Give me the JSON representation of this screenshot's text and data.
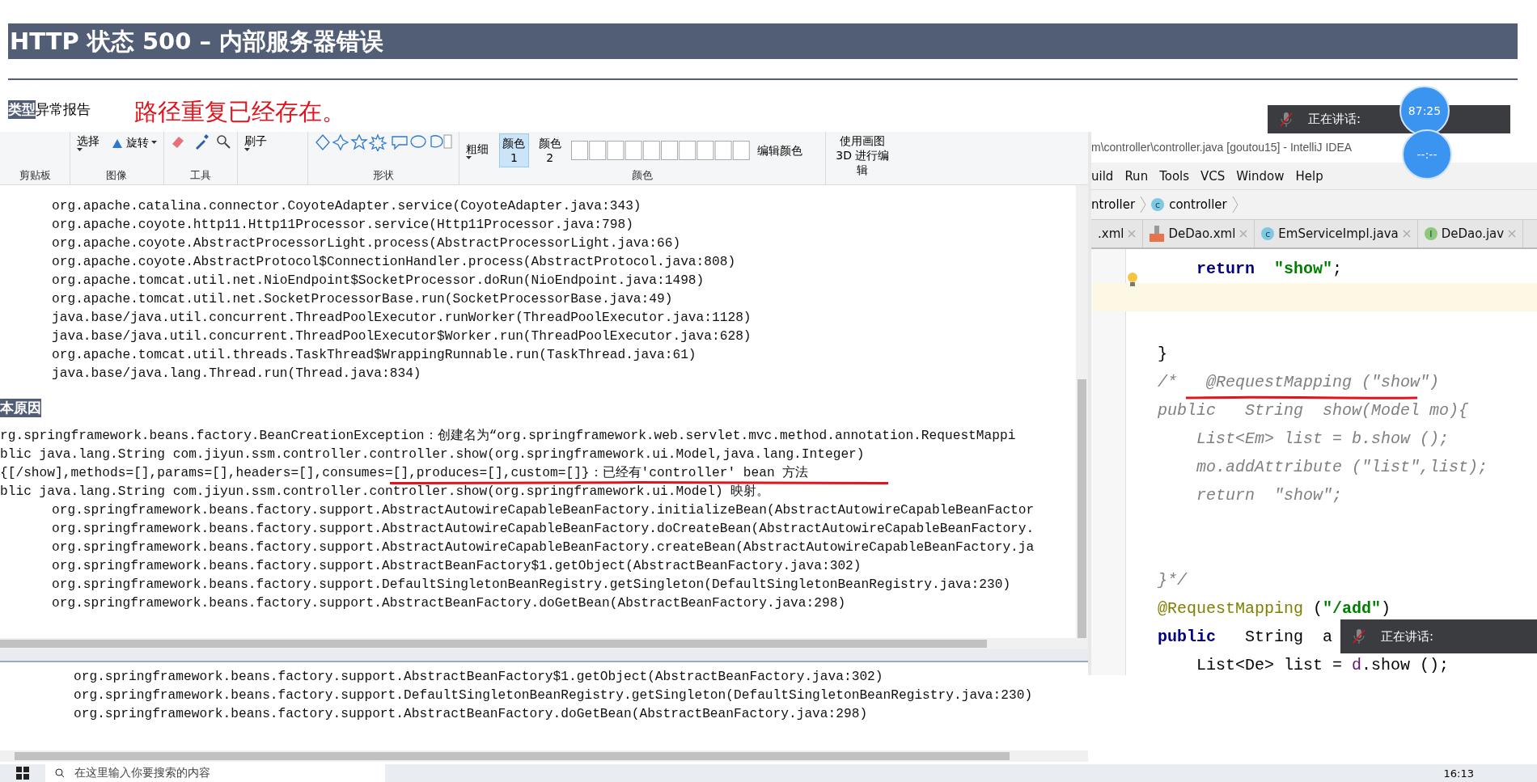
{
  "error_page": {
    "title": "HTTP 状态 500 – 内部服务器错误",
    "type_label": "类型",
    "type_value": "异常报告",
    "annotation": "路径重复已经存在。"
  },
  "paint_ribbon": {
    "groups": [
      {
        "label": "剪贴板"
      },
      {
        "label": "图像",
        "tools": [
          {
            "kind": "stacked",
            "label": "选择"
          },
          {
            "kind": "rotate",
            "label": "旋转"
          }
        ]
      },
      {
        "label": "工具",
        "tools": [
          {
            "kind": "toolset"
          }
        ]
      },
      {
        "tools": [
          {
            "kind": "stacked",
            "label": "刷子"
          }
        ]
      },
      {
        "label": "形状",
        "tools": [
          {
            "kind": "shapes"
          }
        ]
      },
      {
        "label": "颜色",
        "tools": [
          {
            "kind": "stacked",
            "label": "粗细"
          },
          {
            "kind": "color-slot",
            "label": "颜色 1",
            "selected": true
          },
          {
            "kind": "color-slot",
            "label": "颜色 2",
            "selected": false
          },
          {
            "kind": "swatches"
          },
          {
            "kind": "text",
            "label": "编辑颜色"
          }
        ]
      },
      {
        "tools": [
          {
            "kind": "text",
            "label": "使用画图 3D 进行编辑"
          }
        ]
      }
    ]
  },
  "console": {
    "stack_top": [
      "org.apache.catalina.connector.CoyoteAdapter.service(CoyoteAdapter.java:343)",
      "org.apache.coyote.http11.Http11Processor.service(Http11Processor.java:798)",
      "org.apache.coyote.AbstractProcessorLight.process(AbstractProcessorLight.java:66)",
      "org.apache.coyote.AbstractProtocol$ConnectionHandler.process(AbstractProtocol.java:808)",
      "org.apache.tomcat.util.net.NioEndpoint$SocketProcessor.doRun(NioEndpoint.java:1498)",
      "org.apache.tomcat.util.net.SocketProcessorBase.run(SocketProcessorBase.java:49)",
      "java.base/java.util.concurrent.ThreadPoolExecutor.runWorker(ThreadPoolExecutor.java:1128)",
      "java.base/java.util.concurrent.ThreadPoolExecutor$Worker.run(ThreadPoolExecutor.java:628)",
      "org.apache.tomcat.util.threads.TaskThread$WrappingRunnable.run(TaskThread.java:61)",
      "java.base/java.lang.Thread.run(Thread.java:834)"
    ],
    "section_heading": "本原因",
    "cause_lines": [
      "rg.springframework.beans.factory.BeanCreationException：创建名为“org.springframework.web.servlet.mvc.method.annotation.RequestMappi",
      "blic java.lang.String com.jiyun.ssm.controller.controller.show(org.springframework.ui.Model,java.lang.Integer)",
      "{[/show],methods=[],params=[],headers=[],consumes=[],produces=[],custom=[]}：已经有'controller' bean 方法",
      "blic java.lang.String com.jiyun.ssm.controller.controller.show(org.springframework.ui.Model) 映射。"
    ],
    "stack_bottom": [
      "org.springframework.beans.factory.support.AbstractAutowireCapableBeanFactory.initializeBean(AbstractAutowireCapableBeanFactor",
      "org.springframework.beans.factory.support.AbstractAutowireCapableBeanFactory.doCreateBean(AbstractAutowireCapableBeanFactory.",
      "org.springframework.beans.factory.support.AbstractAutowireCapableBeanFactory.createBean(AbstractAutowireCapableBeanFactory.ja",
      "org.springframework.beans.factory.support.AbstractBeanFactory$1.getObject(AbstractBeanFactory.java:302)",
      "org.springframework.beans.factory.support.DefaultSingletonBeanRegistry.getSingleton(DefaultSingletonBeanRegistry.java:230)",
      "org.springframework.beans.factory.support.AbstractBeanFactory.doGetBean(AbstractBeanFactory.java:298)"
    ]
  },
  "lower_console": {
    "lines": [
      "org.springframework.beans.factory.support.AbstractBeanFactory$1.getObject(AbstractBeanFactory.java:302)",
      "org.springframework.beans.factory.support.DefaultSingletonBeanRegistry.getSingleton(DefaultSingletonBeanRegistry.java:230)",
      "org.springframework.beans.factory.support.AbstractBeanFactory.doGetBean(AbstractBeanFactory.java:298)"
    ]
  },
  "ide": {
    "title": "m\\controller\\controller.java [goutou15] - IntelliJ IDEA",
    "menu": [
      "uild",
      "Run",
      "Tools",
      "VCS",
      "Window",
      "Help"
    ],
    "breadcrumb": [
      {
        "kind": "package",
        "label": "ntroller"
      },
      {
        "kind": "class",
        "label": "controller",
        "icon_letter": "c"
      }
    ],
    "tabs": [
      {
        "kind": "plain",
        "label": ".xml"
      },
      {
        "kind": "xml",
        "label": "DeDao.xml"
      },
      {
        "kind": "class",
        "label": "EmServiceImpl.java",
        "icon_letter": "c"
      },
      {
        "kind": "interface",
        "label": "DeDao.jav",
        "icon_letter": "I"
      }
    ],
    "code_lines": [
      {
        "current": false,
        "segments": [
          {
            "kind": "keyword",
            "text": "    return  "
          },
          {
            "kind": "string",
            "text": "\"show\""
          },
          {
            "kind": "plain",
            "text": ";"
          }
        ]
      },
      {
        "current": true
      },
      {
        "current": false
      },
      {
        "current": false,
        "segments": [
          {
            "kind": "plain",
            "text": "}"
          }
        ]
      },
      {
        "current": false,
        "segments": [
          {
            "kind": "comment",
            "text": "/*   @RequestMapping (\"show\")"
          }
        ]
      },
      {
        "current": false,
        "segments": [
          {
            "kind": "comment",
            "text": "public   String  show(Model mo){"
          }
        ]
      },
      {
        "current": false,
        "segments": [
          {
            "kind": "comment",
            "text": "    List<Em> list = b.show ();"
          }
        ]
      },
      {
        "current": false,
        "segments": [
          {
            "kind": "comment",
            "text": "    mo.addAttribute (\"list\",list);"
          }
        ]
      },
      {
        "current": false,
        "segments": [
          {
            "kind": "comment",
            "text": "    return  \"show\";"
          }
        ]
      },
      {
        "current": false
      },
      {
        "current": false
      },
      {
        "current": false,
        "segments": [
          {
            "kind": "comment",
            "text": "}*/"
          }
        ]
      },
      {
        "current": false,
        "segments": [
          {
            "kind": "annotation",
            "text": "@RequestMapping"
          },
          {
            "kind": "plain",
            "text": " ("
          },
          {
            "kind": "string",
            "text": "\"/add\""
          },
          {
            "kind": "plain",
            "text": ")"
          }
        ]
      },
      {
        "current": false,
        "segments": [
          {
            "kind": "keyword",
            "text": "public"
          },
          {
            "kind": "plain",
            "text": "   String  a"
          }
        ]
      },
      {
        "current": false,
        "segments": [
          {
            "kind": "plain",
            "text": "    List<De> list = "
          },
          {
            "kind": "field",
            "text": "d"
          },
          {
            "kind": "plain",
            "text": ".show ();"
          }
        ]
      }
    ]
  },
  "speaking_bars": [
    {
      "label": "正在讲话:"
    },
    {
      "label": "正在讲话:"
    }
  ],
  "timers": [
    "87:25",
    "--:--"
  ],
  "taskbar": {
    "search_placeholder": "在这里输入你要搜索的内容",
    "time": "16:13"
  }
}
